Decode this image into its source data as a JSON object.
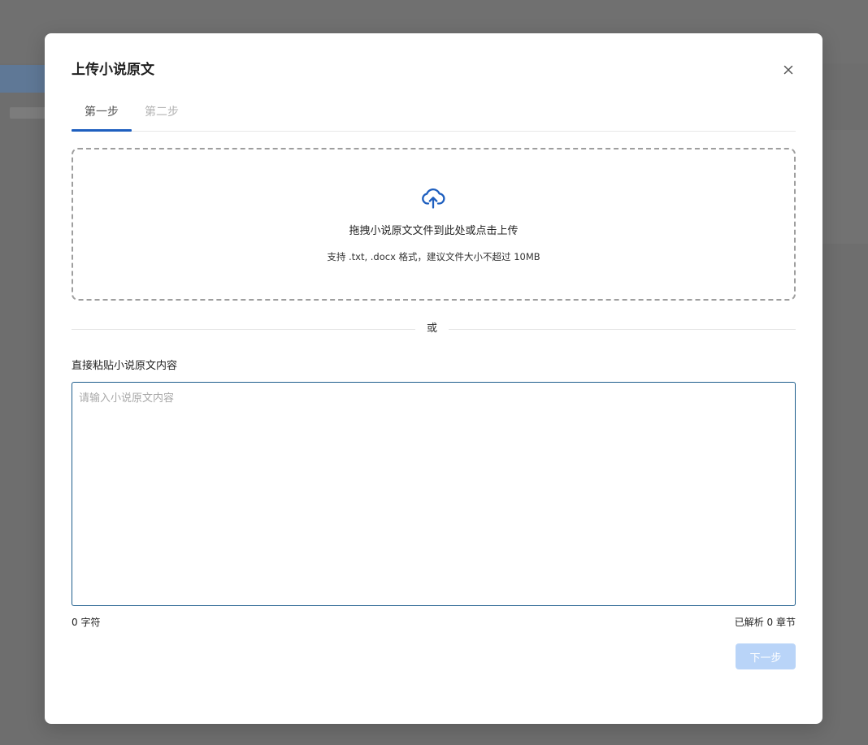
{
  "modal": {
    "title": "上传小说原文",
    "close_icon": "close-icon"
  },
  "tabs": [
    {
      "label": "第一步",
      "active": true
    },
    {
      "label": "第二步",
      "active": false
    }
  ],
  "dropzone": {
    "icon": "cloud-upload-icon",
    "main_text": "拖拽小说原文文件到此处或点击上传",
    "sub_text": "支持 .txt, .docx 格式，建议文件大小不超过 10MB"
  },
  "divider": {
    "text": "或"
  },
  "paste": {
    "label": "直接粘贴小说原文内容",
    "placeholder": "请输入小说原文内容",
    "value": ""
  },
  "stats": {
    "char_count": "0 字符",
    "chapter_count": "已解析 0 章节"
  },
  "footer": {
    "next_label": "下一步",
    "next_disabled": true
  },
  "colors": {
    "accent": "#1e5fbf",
    "button_disabled": "#b9d4f8",
    "overlay": "#6e6e6e",
    "textarea_border": "#1d5d8c"
  }
}
